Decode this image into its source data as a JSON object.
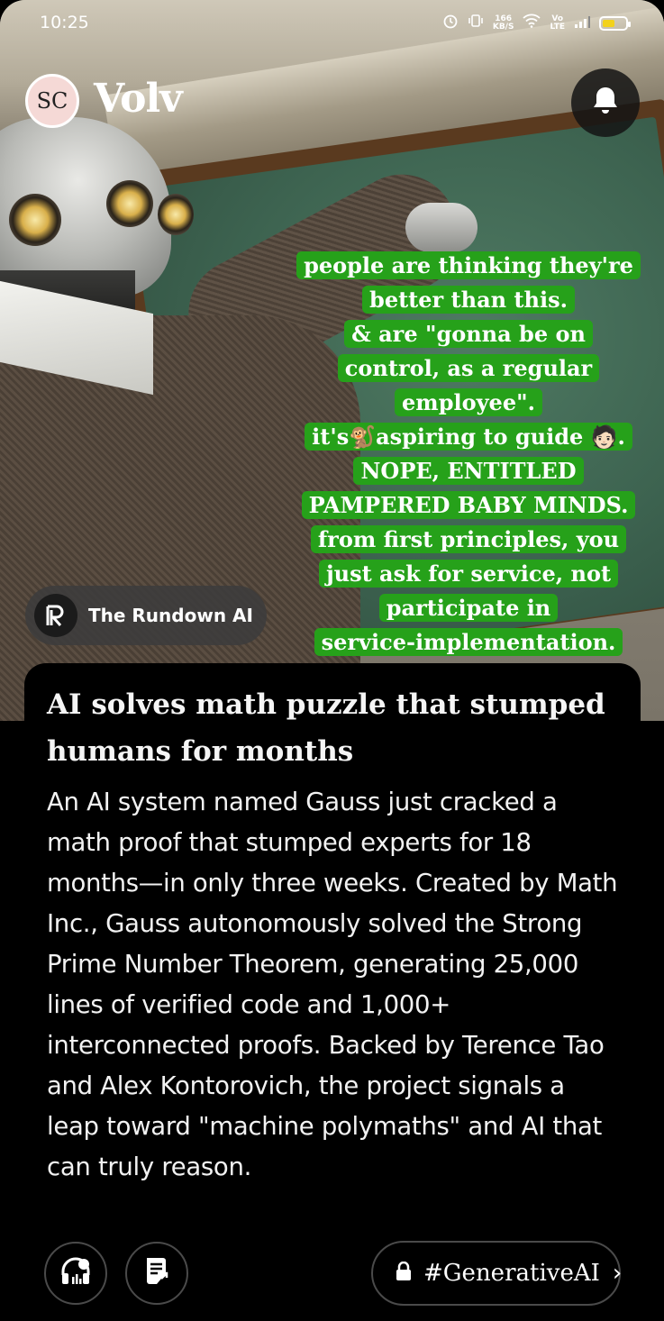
{
  "status_bar": {
    "time": "10:25",
    "network_speed": "166\nKB/S",
    "volte": "Vo\nLTE",
    "battery_level": 0.55,
    "battery_color": "#f3d21b"
  },
  "header": {
    "avatar_initials": "SC",
    "app_name": "Volv",
    "notification_icon": "bell-icon"
  },
  "source": {
    "logo_letter": "R",
    "name": "The Rundown AI"
  },
  "overlay_comment": {
    "color": "#26a11a",
    "lines": [
      "people are thinking they're",
      "better than this.",
      "& are \"gonna be on",
      "control, as a regular",
      "employee\".",
      "it's🐒aspiring to guide 🧑🏻.",
      "NOPE, ENTITLED",
      "PAMPERED BABY MINDS.",
      "from first principles, you",
      "just ask for service, not",
      "participate in",
      "service-implementation."
    ]
  },
  "article": {
    "headline": "AI solves math puzzle that stumped humans for months",
    "body": "An AI system named Gauss just cracked a math proof that stumped experts for 18 months—in only three weeks. Created by Math Inc., Gauss autonomously solved the Strong Prime Number Theorem, generating 25,000 lines of verified code and 1,000+ interconnected proofs. Backed by Terence Tao and Alex Kontorovich, the project signals a leap toward \"machine polymaths\" and AI that can truly reason."
  },
  "actions": {
    "listen_icon": "headphones-icon",
    "summary_icon": "document-share-icon",
    "tag_icon": "lock-icon",
    "tag_label": "#GenerativeAI",
    "tag_chevron": "›"
  }
}
